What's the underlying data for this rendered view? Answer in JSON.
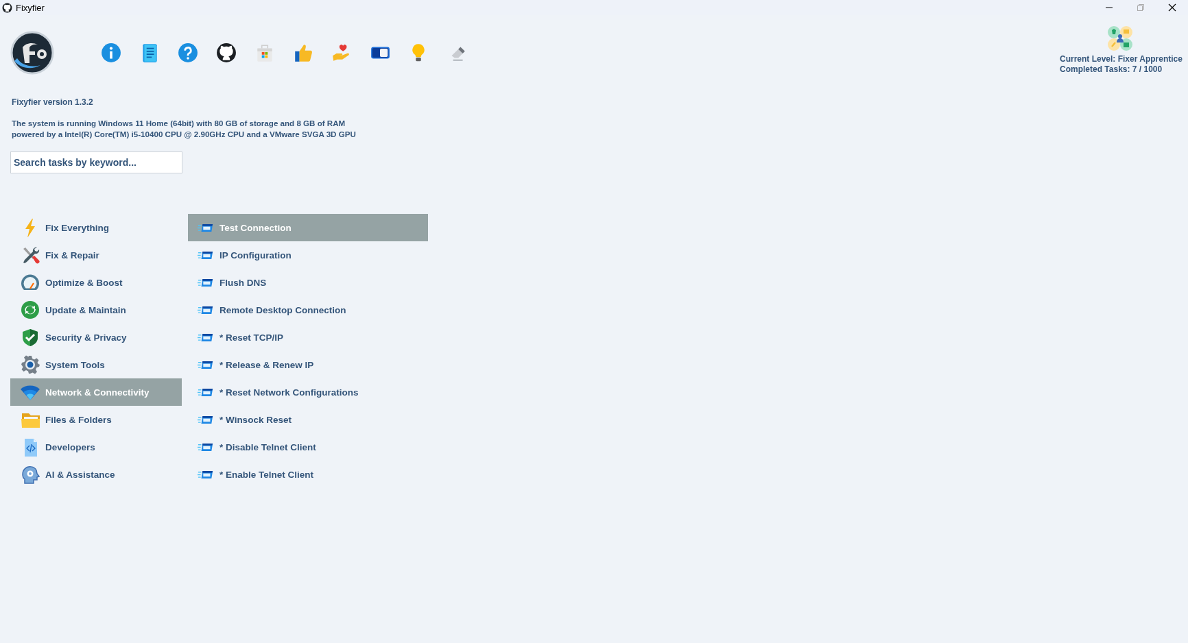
{
  "window": {
    "title": "Fixyfier"
  },
  "version": "Fixyfier version 1.3.2",
  "system_info": [
    "The system is running Windows 11 Home (64bit) with 80 GB of storage and 8 GB of RAM",
    "powered by a Intel(R) Core(TM) i5-10400 CPU @ 2.90GHz CPU and a VMware SVGA 3D GPU"
  ],
  "search": {
    "placeholder": "Search tasks by keyword..."
  },
  "level": {
    "current": "Current Level: Fixer Apprentice",
    "completed": "Completed Tasks: 7 / 1000"
  },
  "categories": [
    {
      "label": "Fix Everything",
      "selected": false
    },
    {
      "label": "Fix & Repair",
      "selected": false
    },
    {
      "label": "Optimize & Boost",
      "selected": false
    },
    {
      "label": "Update & Maintain",
      "selected": false
    },
    {
      "label": "Security & Privacy",
      "selected": false
    },
    {
      "label": "System Tools",
      "selected": false
    },
    {
      "label": "Network & Connectivity",
      "selected": true
    },
    {
      "label": "Files & Folders",
      "selected": false
    },
    {
      "label": "Developers",
      "selected": false
    },
    {
      "label": "AI & Assistance",
      "selected": false
    }
  ],
  "tasks": [
    {
      "label": "Test Connection",
      "selected": true
    },
    {
      "label": "IP Configuration",
      "selected": false
    },
    {
      "label": "Flush DNS",
      "selected": false
    },
    {
      "label": "Remote Desktop Connection",
      "selected": false
    },
    {
      "label": "* Reset TCP/IP",
      "selected": false
    },
    {
      "label": "* Release & Renew IP",
      "selected": false
    },
    {
      "label": "* Reset Network Configurations",
      "selected": false
    },
    {
      "label": "* Winsock Reset",
      "selected": false
    },
    {
      "label": "* Disable Telnet Client",
      "selected": false
    },
    {
      "label": "* Enable Telnet Client",
      "selected": false
    }
  ]
}
